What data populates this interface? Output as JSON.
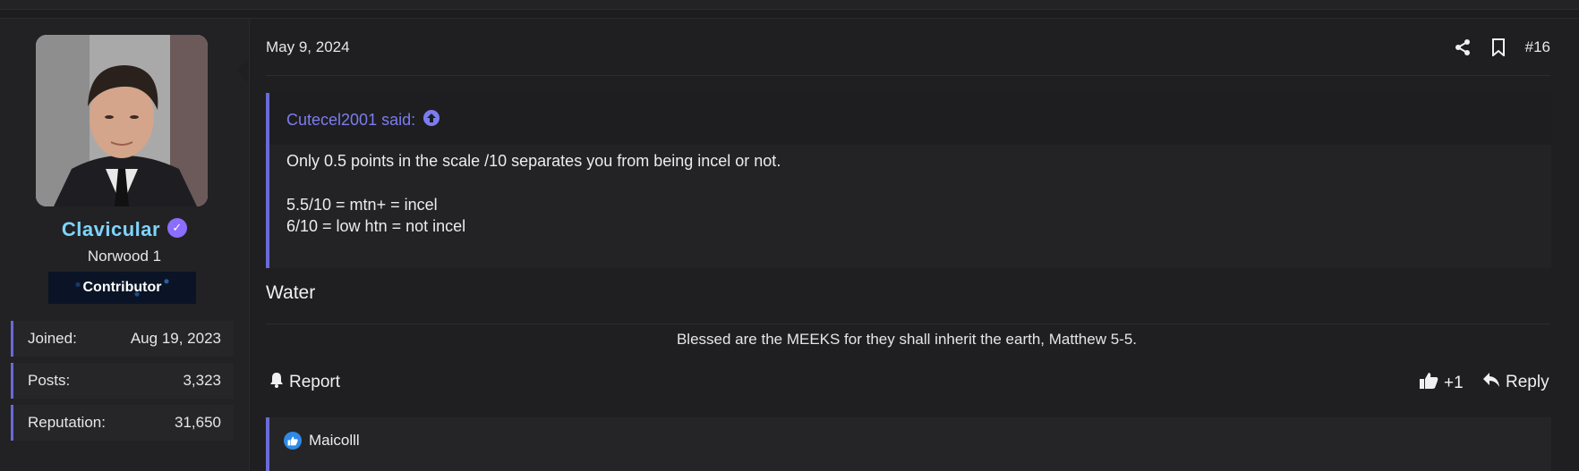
{
  "user": {
    "name": "Clavicular",
    "title": "Norwood 1",
    "banner": "Contributor",
    "stats": [
      {
        "label": "Joined:",
        "value": "Aug 19, 2023"
      },
      {
        "label": "Posts:",
        "value": "3,323"
      },
      {
        "label": "Reputation:",
        "value": "31,650"
      }
    ]
  },
  "post": {
    "date": "May 9, 2024",
    "number": "#16",
    "quote": {
      "author": "Cutecel2001 said:",
      "lines": [
        "Only 0.5 points in the scale /10 separates you from being incel or not.",
        "5.5/10 = mtn+ = incel",
        "6/10 = low htn = not incel"
      ]
    },
    "body": "Water",
    "signature": "Blessed are the MEEKS for they shall inherit the earth, Matthew 5-5.",
    "actions": {
      "report": "Report",
      "like_count": "+1",
      "reply": "Reply"
    },
    "reactions": {
      "user": "Maicolll"
    }
  },
  "colors": {
    "accent": "#6a6ad8",
    "username": "#7fd4ff",
    "quote_author": "#7c7cf0",
    "like": "#2f8ae6"
  }
}
